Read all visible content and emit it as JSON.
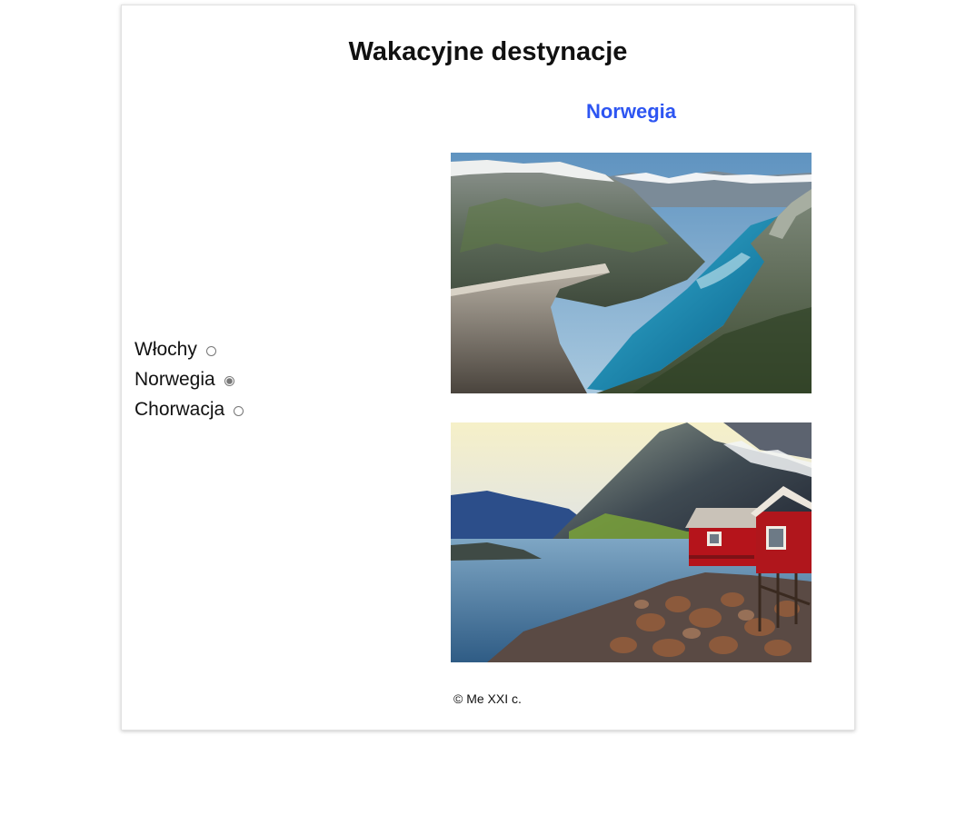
{
  "header": {
    "title": "Wakacyjne destynacje"
  },
  "destination": {
    "selected_title": "Norwegia",
    "title_color": "#2d55f2"
  },
  "options": [
    {
      "label": "Włochy",
      "checked": false
    },
    {
      "label": "Norwegia",
      "checked": true
    },
    {
      "label": "Chorwacja",
      "checked": false
    }
  ],
  "photos": [
    {
      "subject": "fjord-cliff-photo"
    },
    {
      "subject": "red-cabin-lake-photo"
    }
  ],
  "footer": {
    "text": "© Me XXI c."
  }
}
